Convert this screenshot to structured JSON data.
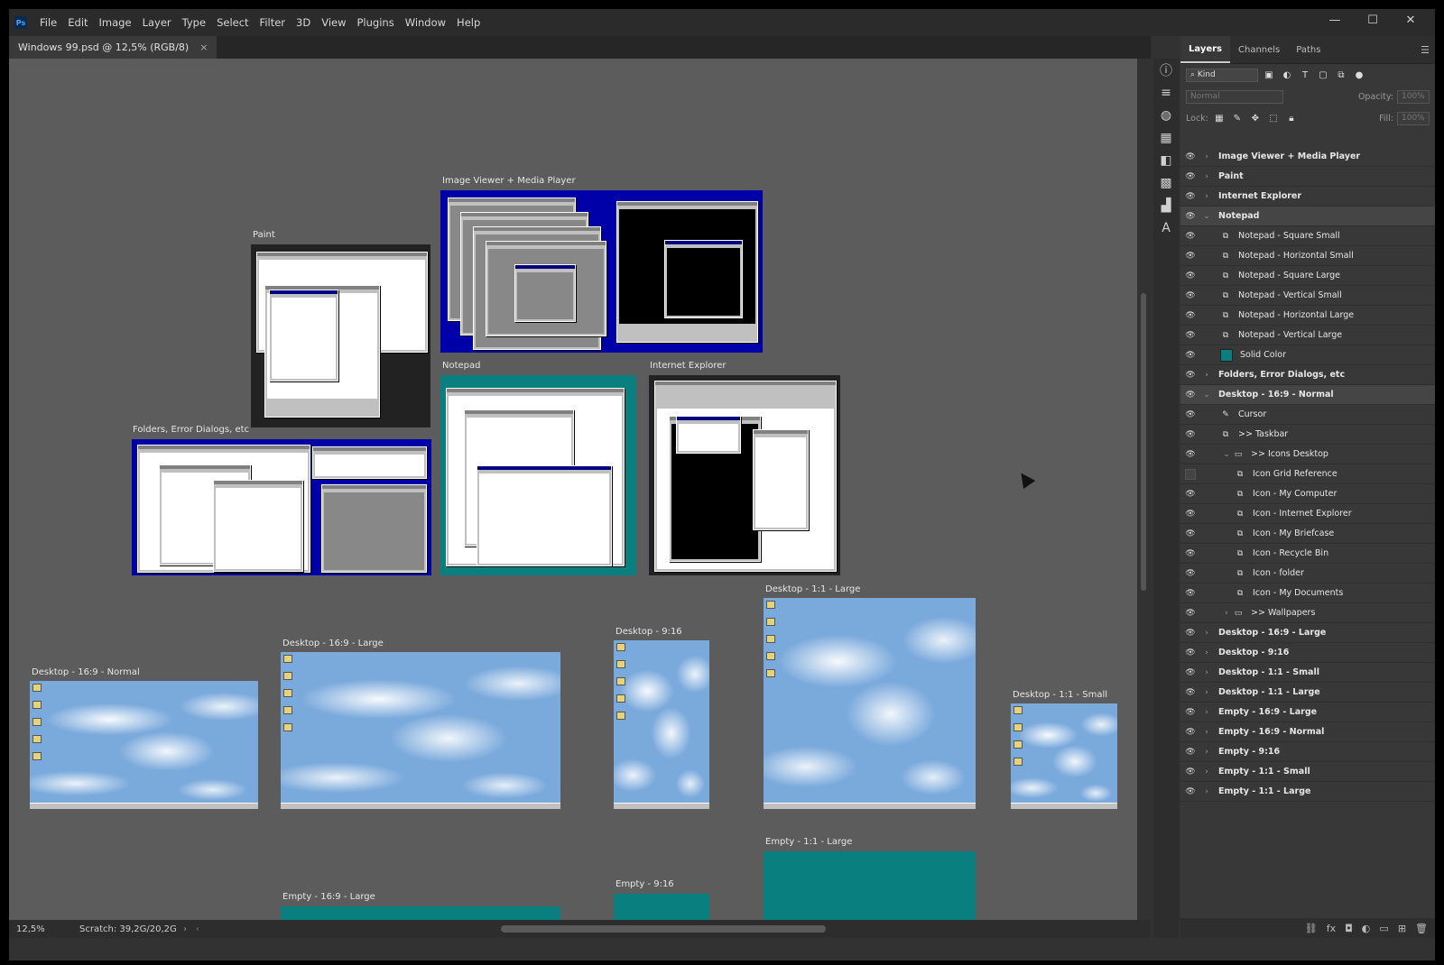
{
  "menubar": {
    "logo": "Ps",
    "items": [
      "File",
      "Edit",
      "Image",
      "Layer",
      "Type",
      "Select",
      "Filter",
      "3D",
      "View",
      "Plugins",
      "Window",
      "Help"
    ],
    "minimize": "—",
    "maximize": "☐",
    "close": "✕"
  },
  "document_tab": {
    "title": "Windows 99.psd @ 12,5% (RGB/8)",
    "close": "×"
  },
  "artboards": [
    "Image Viewer + Media Player",
    "Paint",
    "Notepad",
    "Internet Explorer",
    "Folders, Error Dialogs, etc",
    "Desktop - 1:1 - Large",
    "Desktop - 9:16",
    "Desktop - 16:9 - Normal",
    "Desktop - 16:9 - Large",
    "Desktop - 1:1 - Small",
    "Empty - 1:1 - Large",
    "Empty - 9:16",
    "Empty - 16:9 - Large"
  ],
  "statusbar": {
    "zoom": "12,5%",
    "scratch": "Scratch: 39,2G/20,2G",
    "arrow": "›",
    "left": "‹"
  },
  "panel": {
    "tabs": [
      "Layers",
      "Channels",
      "Paths"
    ],
    "filter_kind": "Kind",
    "blend_mode": "Normal",
    "opacity_label": "Opacity:",
    "opacity_value": "100%",
    "lock_label": "Lock:",
    "fill_label": "Fill:",
    "fill_value": "100%"
  },
  "layers": [
    {
      "name": "Image Viewer + Media Player",
      "group": true,
      "arrow": "›"
    },
    {
      "name": "Paint",
      "group": true,
      "arrow": "›"
    },
    {
      "name": "Internet Explorer",
      "group": true,
      "arrow": "›"
    },
    {
      "name": "Notepad",
      "group": true,
      "arrow": "⌄",
      "selected": true
    },
    {
      "name": "Notepad - Square Small"
    },
    {
      "name": "Notepad - Horizontal Small"
    },
    {
      "name": "Notepad - Square Large"
    },
    {
      "name": "Notepad - Vertical Small"
    },
    {
      "name": "Notepad - Horizontal Large"
    },
    {
      "name": "Notepad - Vertical Large"
    },
    {
      "name": "Solid Color",
      "swatch": true
    },
    {
      "name": "Folders, Error Dialogs, etc",
      "group": true,
      "arrow": "›"
    },
    {
      "name": "Desktop - 16:9 - Normal",
      "group": true,
      "arrow": "⌄",
      "selected": true
    },
    {
      "name": "Cursor",
      "brush": true
    },
    {
      "name": ">> Taskbar"
    },
    {
      "name": ">> Icons Desktop",
      "folder": true,
      "arrow": "⌄"
    },
    {
      "name": "Icon Grid Reference",
      "hidden": true
    },
    {
      "name": "Icon - My Computer"
    },
    {
      "name": "Icon - Internet Explorer"
    },
    {
      "name": "Icon - My Briefcase"
    },
    {
      "name": "Icon - Recycle Bin"
    },
    {
      "name": "Icon - folder"
    },
    {
      "name": "Icon - My Documents"
    },
    {
      "name": ">> Wallpapers",
      "folder": true,
      "arrow": "›"
    },
    {
      "name": "Desktop - 16:9 - Large",
      "group": true,
      "arrow": "›"
    },
    {
      "name": "Desktop - 9:16",
      "group": true,
      "arrow": "›"
    },
    {
      "name": "Desktop - 1:1 - Small",
      "group": true,
      "arrow": "›"
    },
    {
      "name": "Desktop - 1:1 - Large",
      "group": true,
      "arrow": "›"
    },
    {
      "name": "Empty - 16:9 - Large",
      "group": true,
      "arrow": "›"
    },
    {
      "name": "Empty - 16:9 - Normal",
      "group": true,
      "arrow": "›"
    },
    {
      "name": "Empty - 9:16",
      "group": true,
      "arrow": "›"
    },
    {
      "name": "Empty - 1:1 - Small",
      "group": true,
      "arrow": "›"
    },
    {
      "name": "Empty - 1:1 - Large",
      "group": true,
      "arrow": "›"
    }
  ]
}
